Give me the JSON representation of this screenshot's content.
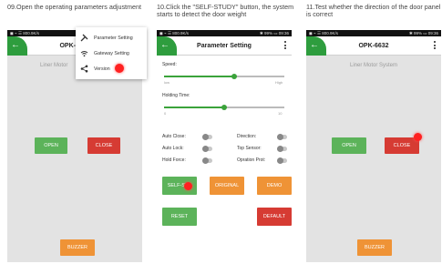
{
  "captions": [
    "09.Open the operating parameters adjustment",
    "10.Click the \"SELF-STUDY\" button, the system starts to detect the door weight",
    "11.Test whether the direction of the door panel is correct"
  ],
  "status_left": "◼ ⌁ ☰ 800.9K/s",
  "status_right": "✱ 99% ▭ 09:36",
  "screen1": {
    "title": "OPK-6632",
    "subtitle": "Liner Motor",
    "menu": [
      "Parameter Setting",
      "Gateway Setting",
      "Version"
    ],
    "open": "OPEN",
    "close": "CLOSE",
    "buzzer": "BUZZER"
  },
  "screen2": {
    "title": "Parameter Setting",
    "speed_label": "Speed:",
    "speed_low": "low",
    "speed_high": "High",
    "hold_label": "Holding Time:",
    "hold_min": "0",
    "hold_max": "10",
    "speed_level": 0.58,
    "hold_level": 0.5,
    "toggles": [
      {
        "label": "Auto Close:"
      },
      {
        "label": "Direction:"
      },
      {
        "label": "Auto Lock:"
      },
      {
        "label": "Top Sensor:"
      },
      {
        "label": "Hold Force:"
      },
      {
        "label": "Opration Prot:"
      }
    ],
    "buttons": [
      "SELF-ST...",
      "ORIGINAL",
      "DEMO",
      "RESET",
      "DEFAULT"
    ]
  },
  "screen3": {
    "title": "OPK-6632",
    "subtitle": "Liner Motor System",
    "open": "OPEN",
    "close": "CLOSE",
    "buzzer": "BUZZER"
  },
  "colors": {
    "accent_green": "#2e9d3e",
    "open_green": "#5cb35a",
    "close_red": "#d63b33",
    "buzzer_orange": "#ef9336",
    "indicator_red": "#ff2020"
  }
}
